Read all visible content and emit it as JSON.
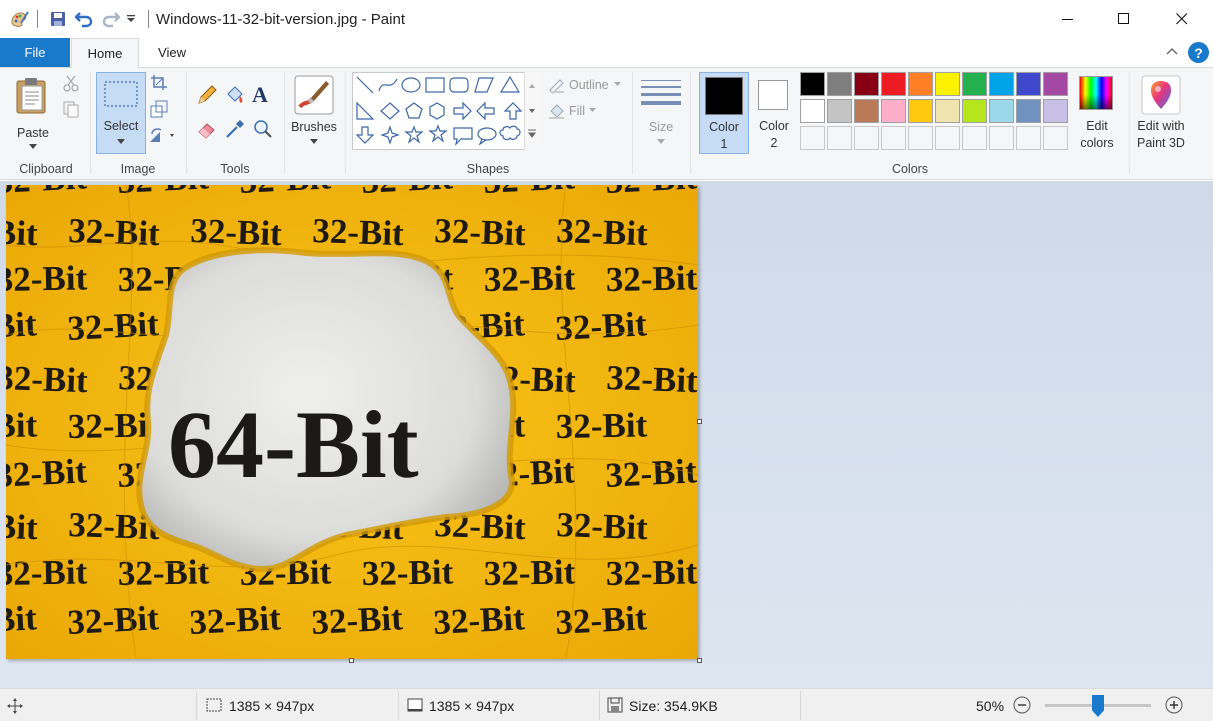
{
  "window": {
    "title": "Windows-11-32-bit-version.jpg - Paint",
    "minimize_glyph": "—",
    "maximize_glyph": "☐",
    "close_glyph": "✕"
  },
  "tabs": [
    {
      "label": "File"
    },
    {
      "label": "Home"
    },
    {
      "label": "View"
    }
  ],
  "ribbon": {
    "clipboard": {
      "group": "Clipboard",
      "paste": "Paste"
    },
    "image": {
      "group": "Image",
      "select": "Select"
    },
    "tools": {
      "group": "Tools"
    },
    "brushes": {
      "label": "Brushes"
    },
    "shapes": {
      "group": "Shapes",
      "outline": "Outline",
      "fill": "Fill"
    },
    "size": {
      "label": "Size"
    },
    "colors": {
      "group": "Colors",
      "color1": "Color",
      "color1_num": "1",
      "color2": "Color",
      "color2_num": "2",
      "edit": "Edit",
      "edit2": "colors",
      "color1_value": "#000000",
      "color2_value": "#ffffff",
      "palette_row1": [
        "#000000",
        "#7f7f7f",
        "#880015",
        "#ed1c24",
        "#ff7f27",
        "#fff200",
        "#22b14c",
        "#00a2e8",
        "#3f48cc",
        "#a349a4"
      ],
      "palette_row2": [
        "#ffffff",
        "#c3c3c3",
        "#b97a57",
        "#ffaec9",
        "#ffc90e",
        "#efe4b0",
        "#b5e61d",
        "#99d9ea",
        "#7092be",
        "#c8bfe7"
      ]
    },
    "paint3d": {
      "line1": "Edit with",
      "line2": "Paint 3D"
    }
  },
  "image": {
    "headline": "64-Bit",
    "background_word": "32-Bit",
    "paper_color": "#f5b800"
  },
  "status": {
    "selection_size": "1385 × 947px",
    "image_size": "1385 × 947px",
    "file_size": "Size: 354.9KB",
    "zoom": "50%",
    "zoom_slider_fraction": 0.5
  }
}
